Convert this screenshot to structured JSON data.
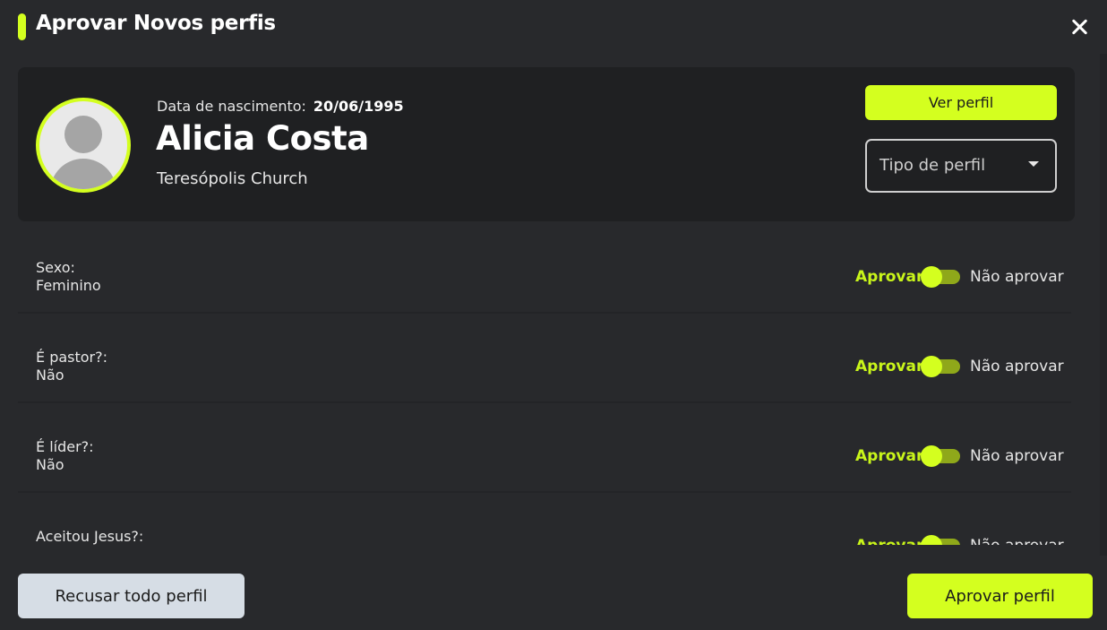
{
  "header": {
    "title": "Aprovar Novos perfis"
  },
  "profile": {
    "dob_label": "Data de nascimento:",
    "dob_value": "20/06/1995",
    "name": "Alicia Costa",
    "church": "Teresópolis Church",
    "view_button": "Ver perfil",
    "profile_type_placeholder": "Tipo de perfil"
  },
  "fields": [
    {
      "label": "Sexo:",
      "value": "Feminino",
      "approve": "Aprovar",
      "reject": "Não aprovar"
    },
    {
      "label": "É pastor?:",
      "value": "Não",
      "approve": "Aprovar",
      "reject": "Não aprovar"
    },
    {
      "label": "É líder?:",
      "value": "Não",
      "approve": "Aprovar",
      "reject": "Não aprovar"
    },
    {
      "label": "Aceitou Jesus?:",
      "value": "",
      "approve": "Aprovar",
      "reject": "Não aprovar"
    }
  ],
  "footer": {
    "reject_all": "Recusar todo perfil",
    "approve_profile": "Aprovar perfil"
  },
  "colors": {
    "accent": "#d4ff1f",
    "background": "#28292c",
    "card": "#1f2022"
  },
  "icons": {
    "close": "close-icon",
    "avatar": "user-avatar-icon",
    "caret": "chevron-down-icon"
  }
}
